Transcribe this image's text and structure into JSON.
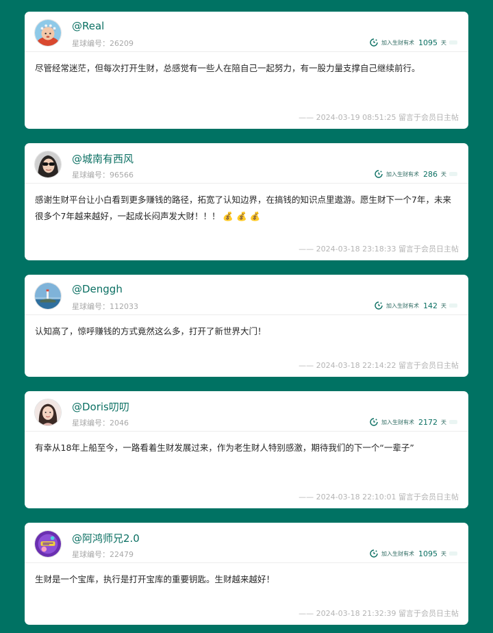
{
  "posts": [
    {
      "username": "@Real",
      "member_id": "星球编号：26209",
      "badge_label": "加入生财有术",
      "days": "1095",
      "days_unit": "天",
      "content": "尽管经常迷茫，但每次打开生财，总感觉有一些人在陪自己一起努力，有一股力量支撑自己继续前行。",
      "footer": "—— 2024-03-19 08:51:25 留言于会员日主帖",
      "avatar_icon": "baby-photo"
    },
    {
      "username": "@城南有西风",
      "member_id": "星球编号：96566",
      "badge_label": "加入生财有术",
      "days": "286",
      "days_unit": "天",
      "content": "感谢生财平台让小白看到更多赚钱的路径，拓宽了认知边界，在搞钱的知识点里遨游。愿生财下一个7年，未来很多个7年越来越好，一起成长闷声发大财！！！ 💰 💰 💰",
      "footer": "—— 2024-03-18 23:18:33 留言于会员日主帖",
      "avatar_icon": "woman-sunglasses-photo"
    },
    {
      "username": "@Denggh",
      "member_id": "星球编号：112033",
      "badge_label": "加入生财有术",
      "days": "142",
      "days_unit": "天",
      "content": "认知高了，惊呼赚钱的方式竟然这么多，打开了新世界大门！",
      "footer": "—— 2024-03-18 22:14:22 留言于会员日主帖",
      "avatar_icon": "lighthouse-photo"
    },
    {
      "username": "@Doris叨叨",
      "member_id": "星球编号：2046",
      "badge_label": "加入生财有术",
      "days": "2172",
      "days_unit": "天",
      "content": "有幸从18年上船至今，一路看着生财发展过来，作为老生财人特别感激，期待我们的下一个“一辈子”",
      "footer": "—— 2024-03-18 22:10:01 留言于会员日主帖",
      "avatar_icon": "woman-portrait-photo"
    },
    {
      "username": "@阿鸿师兄2.0",
      "member_id": "星球编号：22479",
      "badge_label": "加入生财有术",
      "days": "1095",
      "days_unit": "天",
      "content": "生财是一个宝库，执行是打开宝库的重要钥匙。生财越来越好！",
      "footer": "—— 2024-03-18 21:32:39 留言于会员日主帖",
      "avatar_icon": "purple-cartoon-logo"
    }
  ],
  "colors": {
    "background": "#007263",
    "accent": "#0a6f62",
    "card": "#ffffff"
  }
}
